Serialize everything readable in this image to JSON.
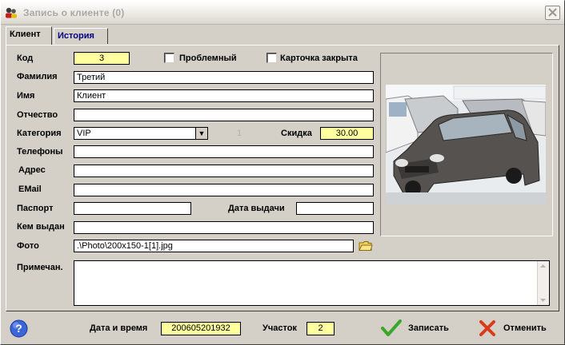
{
  "window": {
    "title": "Запись о клиенте  (0)"
  },
  "tabs": [
    {
      "label": "Клиент"
    },
    {
      "label": "История"
    }
  ],
  "form": {
    "code_label": "Код",
    "code_value": "3",
    "problem_label": "Проблемный",
    "card_closed_label": "Карточка закрыта",
    "surname_label": "Фамилия",
    "surname_value": "Третий",
    "name_label": "Имя",
    "name_value": "Клиент",
    "patronymic_label": "Отчество",
    "patronymic_value": "",
    "category_label": "Категория",
    "category_value": "VIP",
    "category_num": "1",
    "discount_label": "Скидка",
    "discount_value": "30.00",
    "phones_label": "Телефоны",
    "phones_value": "",
    "address_label": "Адрес",
    "address_value": "",
    "email_label": "EMail",
    "email_value": "",
    "passport_label": "Паспорт",
    "passport_value": "",
    "issue_date_label": "Дата выдачи",
    "issue_date_value": "",
    "issued_by_label": "Кем выдан",
    "issued_by_value": "",
    "photo_label": "Фото",
    "photo_value": ".\\Photo\\200x150-1[1].jpg",
    "notes_label": "Примечан.",
    "notes_value": ""
  },
  "footer": {
    "datetime_label": "Дата и время",
    "datetime_value": "200605201932",
    "site_label": "Участок",
    "site_value": "2",
    "save_label": "Записать",
    "cancel_label": "Отменить"
  },
  "icons": {
    "title": "users-icon",
    "close": "close-icon",
    "help": "help-icon",
    "folder": "folder-icon",
    "save": "checkmark-icon",
    "cancel": "cancel-x-icon",
    "combo": "chevron-down-icon"
  },
  "colors": {
    "highlight_field": "#ffffa0",
    "save_check": "#3aa62a",
    "cancel_x": "#d83a1a",
    "tab_inactive_text": "#000080"
  }
}
